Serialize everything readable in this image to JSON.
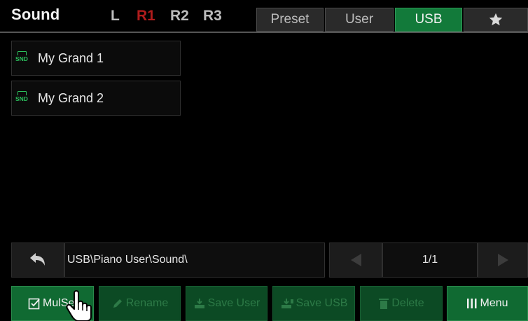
{
  "header": {
    "title": "Sound",
    "parts": [
      {
        "label": "L",
        "active": false
      },
      {
        "label": "R1",
        "active": true
      },
      {
        "label": "R2",
        "active": false
      },
      {
        "label": "R3",
        "active": false
      }
    ],
    "tabs": [
      {
        "label": "Preset",
        "active": false
      },
      {
        "label": "User",
        "active": false
      },
      {
        "label": "USB",
        "active": true
      },
      {
        "icon": "star-icon",
        "active": false
      }
    ]
  },
  "files": [
    {
      "icon": "snd-file-icon",
      "icon_text": "SND",
      "label": "My Grand 1"
    },
    {
      "icon": "snd-file-icon",
      "icon_text": "SND",
      "label": "My Grand 2"
    }
  ],
  "path_bar": {
    "back_icon": "back-arrow-icon",
    "path": "USB\\Piano User\\Sound\\",
    "page_indicator": "1/1"
  },
  "toolbar": {
    "mulsel": {
      "label": "MulSel",
      "icon": "checkbox-icon",
      "enabled": true
    },
    "rename": {
      "label": "Rename",
      "icon": "pencil-icon",
      "enabled": false
    },
    "save_user": {
      "label": "Save User",
      "icon": "save-icon",
      "enabled": false
    },
    "save_usb": {
      "label": "Save USB",
      "icon": "usb-save-icon",
      "enabled": false
    },
    "delete": {
      "label": "Delete",
      "icon": "trash-icon",
      "enabled": false
    },
    "menu": {
      "label": "Menu",
      "icon": "menu-bars-icon",
      "enabled": true
    }
  },
  "colors": {
    "accent_green": "#127a3a",
    "active_part_red": "#b01c1c",
    "file_icon_green": "#2bbf5c"
  }
}
